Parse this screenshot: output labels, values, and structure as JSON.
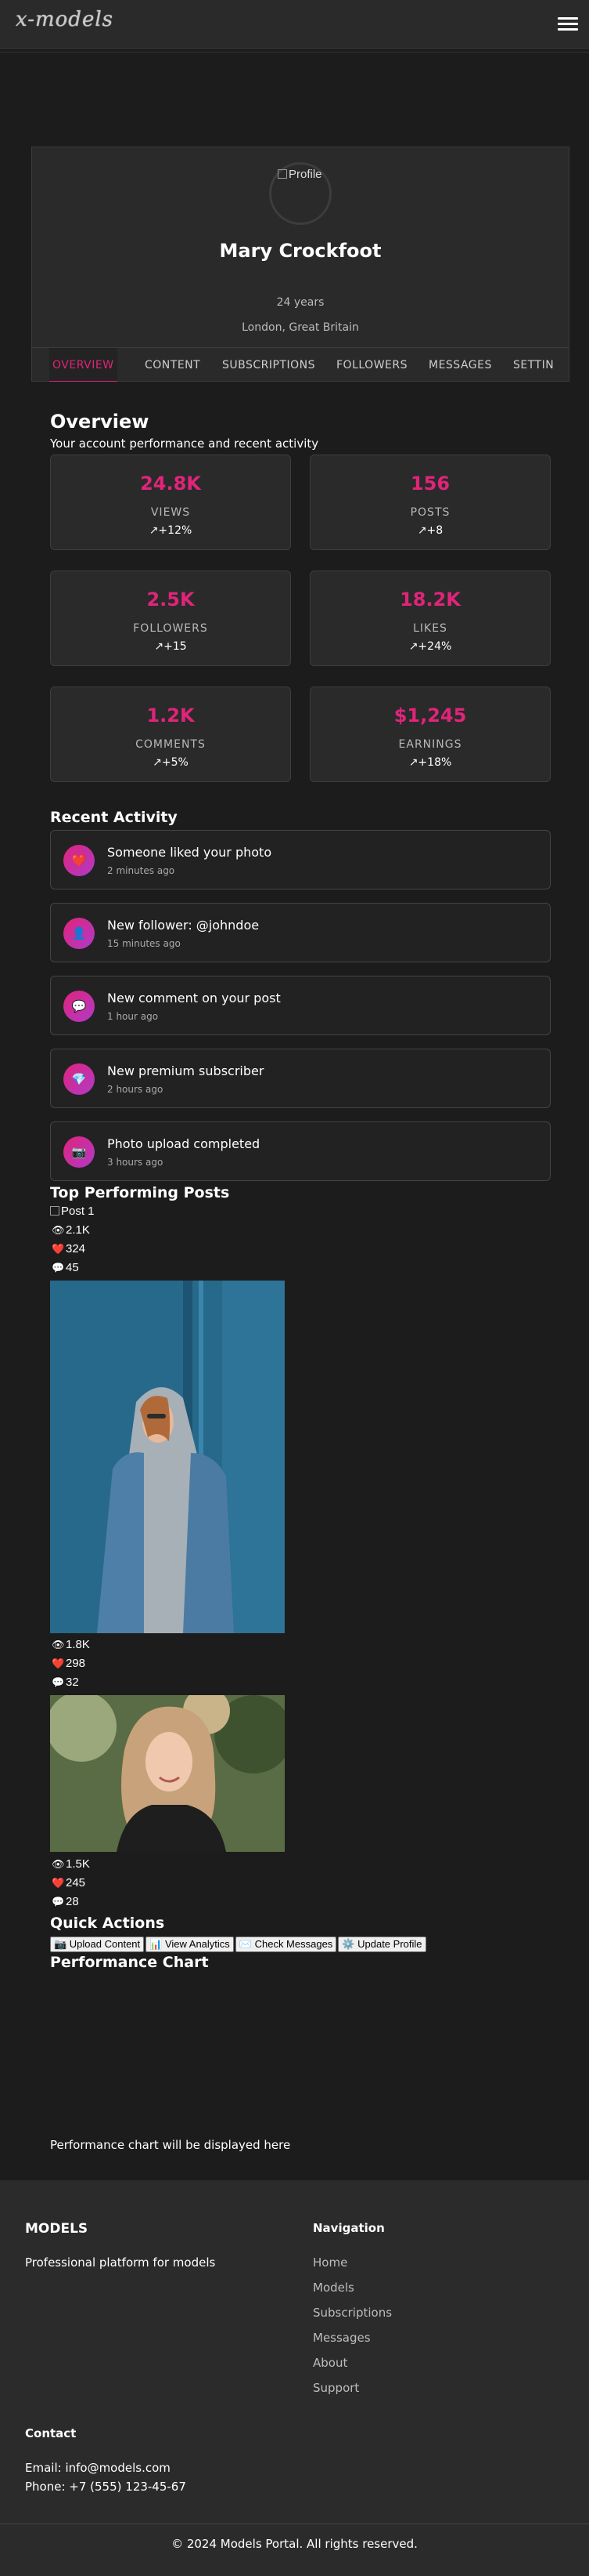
{
  "header": {
    "logo_text": "x-models",
    "menu_icon": "hamburger-icon"
  },
  "profile": {
    "avatar_alt": "Profile",
    "name": "Mary Crockfoot",
    "age": "24 years",
    "location": "London, Great Britain",
    "tabs": [
      "OVERVIEW",
      "CONTENT",
      "SUBSCRIPTIONS",
      "FOLLOWERS",
      "MESSAGES",
      "SETTIN"
    ],
    "active_tab": "OVERVIEW"
  },
  "overview": {
    "title": "Overview",
    "subtitle": "Your account performance and recent activity",
    "stats": [
      {
        "value": "24.8K",
        "label": "VIEWS",
        "change": "↗+12%"
      },
      {
        "value": "156",
        "label": "POSTS",
        "change": "↗+8"
      },
      {
        "value": "2.5K",
        "label": "FOLLOWERS",
        "change": "↗+15"
      },
      {
        "value": "18.2K",
        "label": "LIKES",
        "change": "↗+24%"
      },
      {
        "value": "1.2K",
        "label": "COMMENTS",
        "change": "↗+5%"
      },
      {
        "value": "$1,245",
        "label": "EARNINGS",
        "change": "↗+18%"
      }
    ]
  },
  "recent_activity": {
    "title": "Recent Activity",
    "items": [
      {
        "icon": "❤️",
        "icon_name": "heart-icon",
        "text": "Someone liked your photo",
        "time": "2 minutes ago"
      },
      {
        "icon": "👤",
        "icon_name": "user-icon",
        "text": "New follower: @johndoe",
        "time": "15 minutes ago"
      },
      {
        "icon": "💬",
        "icon_name": "comment-icon",
        "text": "New comment on your post",
        "time": "1 hour ago"
      },
      {
        "icon": "💎",
        "icon_name": "diamond-icon",
        "text": "New premium subscriber",
        "time": "2 hours ago"
      },
      {
        "icon": "📷",
        "icon_name": "camera-icon",
        "text": "Photo upload completed",
        "time": "3 hours ago"
      }
    ]
  },
  "top_posts": {
    "title": "Top Performing Posts",
    "posts": [
      {
        "alt": "Post 1",
        "views": "2.1K",
        "likes": "324",
        "comments": "45"
      },
      {
        "alt": "",
        "views": "1.8K",
        "likes": "298",
        "comments": "32"
      },
      {
        "alt": "",
        "views": "1.5K",
        "likes": "245",
        "comments": "28"
      }
    ]
  },
  "quick_actions": {
    "title": "Quick Actions",
    "buttons": [
      "📷 Upload Content",
      "📊 View Analytics",
      "✉️ Check Messages",
      "⚙️ Update Profile"
    ]
  },
  "performance": {
    "title": "Performance Chart",
    "placeholder": "Performance chart will be displayed here"
  },
  "footer": {
    "brand": "MODELS",
    "description": "Professional platform for models",
    "nav_title": "Navigation",
    "nav_links": [
      "Home",
      "Models",
      "Subscriptions",
      "Messages",
      "About",
      "Support"
    ],
    "contact_title": "Contact",
    "email": "Email: info@models.com",
    "phone": "Phone: +7 (555) 123-45-67",
    "copyright": "© 2024 Models Portal. All rights reserved."
  },
  "colors": {
    "accent": "#e0247a",
    "background": "#1c1c1c",
    "card": "#2a2a2a"
  }
}
